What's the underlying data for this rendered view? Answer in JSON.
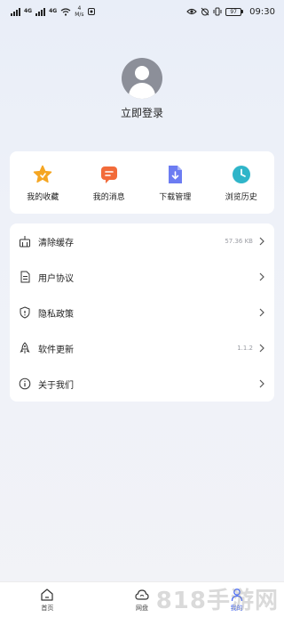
{
  "status_bar": {
    "net_1": "4G",
    "net_2": "4G",
    "speed_value": "4",
    "speed_unit": "M/s",
    "battery": "97",
    "time": "09:30"
  },
  "profile": {
    "login_text": "立即登录"
  },
  "quick_actions": [
    {
      "label": "我的收藏",
      "icon": "star-icon",
      "color": "#f5a623"
    },
    {
      "label": "我的消息",
      "icon": "message-icon",
      "color": "#f26b3a"
    },
    {
      "label": "下载管理",
      "icon": "download-icon",
      "color": "#6c7cf2"
    },
    {
      "label": "浏览历史",
      "icon": "clock-icon",
      "color": "#2fb5c9"
    }
  ],
  "menu": [
    {
      "label": "清除缓存",
      "value": "57.36 KB",
      "icon": "broom-icon"
    },
    {
      "label": "用户协议",
      "value": "",
      "icon": "document-icon"
    },
    {
      "label": "隐私政策",
      "value": "",
      "icon": "shield-icon"
    },
    {
      "label": "软件更新",
      "value": "1.1.2",
      "icon": "rocket-icon"
    },
    {
      "label": "关于我们",
      "value": "",
      "icon": "info-icon"
    }
  ],
  "bottom_nav": [
    {
      "label": "首页",
      "icon": "home-icon",
      "active": false
    },
    {
      "label": "网盘",
      "icon": "cloud-drive-icon",
      "active": false
    },
    {
      "label": "我的",
      "icon": "user-icon",
      "active": true
    }
  ],
  "watermark": "818手游网",
  "colors": {
    "accent": "#4a6cf7",
    "background": "#f2f3f7"
  }
}
